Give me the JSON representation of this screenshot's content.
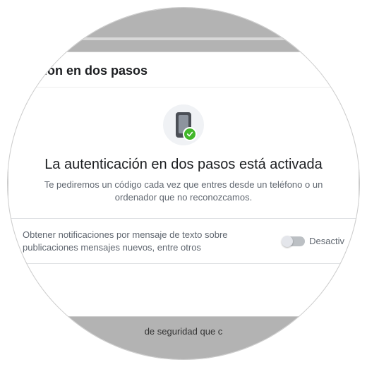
{
  "panel": {
    "title_fragment": "cación en dos pasos"
  },
  "status": {
    "title": "La autenticación en dos pasos está activada",
    "description": "Te pediremos un código cada vez que entres desde un teléfono o un ordenador que no reconozcamos."
  },
  "notifications": {
    "text": "Obtener notificaciones por mensaje de texto sobre publicaciones mensajes nuevos, entre otros",
    "toggle_state": "off",
    "toggle_label": "Desactiv"
  },
  "footer": {
    "fragment": "de seguridad que c"
  }
}
